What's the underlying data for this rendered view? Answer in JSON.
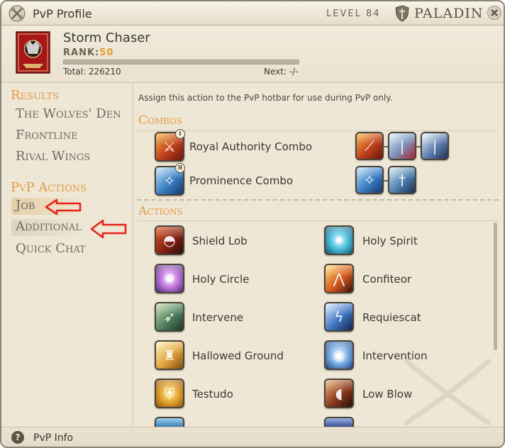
{
  "window": {
    "title": "PvP Profile",
    "level_label": "LEVEL",
    "level_value": "84",
    "job": "PALADIN"
  },
  "profile": {
    "name": "Storm Chaser",
    "rank_label": "RANK:",
    "rank_value": "50",
    "progress_fraction": 1.0,
    "total": "Total: 226210",
    "next": "Next: -/-"
  },
  "nav": {
    "results_heading": "Results",
    "results": [
      "The Wolves' Den",
      "Frontline",
      "Rival Wings"
    ],
    "actions_heading": "PvP Actions",
    "actions": [
      "Job",
      "Additional",
      "Quick Chat"
    ]
  },
  "content": {
    "assign_text": "Assign this action to the PvP hotbar for use during PvP only.",
    "combos_heading": "Combos",
    "combos": [
      {
        "label": "Royal Authority Combo",
        "badge": "I"
      },
      {
        "label": "Prominence Combo",
        "badge": "II"
      }
    ],
    "actions_heading": "Actions",
    "actions_left": [
      "Shield Lob",
      "Holy Circle",
      "Intervene",
      "Hallowed Ground",
      "Testudo"
    ],
    "actions_right": [
      "Holy Spirit",
      "Confiteor",
      "Requiescat",
      "Intervention",
      "Low Blow"
    ]
  },
  "footer": {
    "info": "PvP Info"
  },
  "colors": {
    "accent": "#e39a47",
    "rank_value": "#e59a2e",
    "annotation_arrow": "#e8221a",
    "background": "#efe7d6"
  },
  "icons": {
    "title": "pvp-crossed-swords-icon",
    "job": "paladin-shield-icon",
    "close": "close-icon",
    "help": "help-icon"
  }
}
